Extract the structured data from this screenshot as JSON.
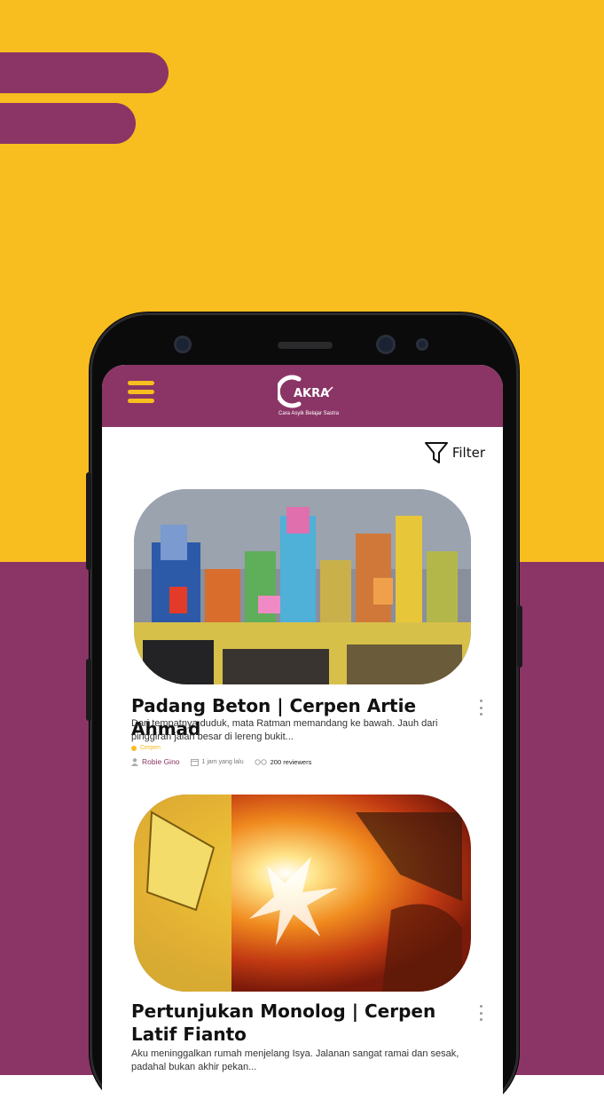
{
  "app": {
    "logo_text": "AKRA",
    "tagline": "Cara Asyik Belajar Sastra",
    "colors": {
      "primary": "#8A3566",
      "accent": "#F8BD1F",
      "background": "#ffffff"
    }
  },
  "toolbar": {
    "menu_icon": "hamburger-menu-icon",
    "filter_label": "Filter",
    "filter_icon": "funnel-icon"
  },
  "posts": [
    {
      "title": "Padang Beton | Cerpen Artie Ahmad",
      "excerpt": "Dari tempatnya duduk, mata Ratman memandang ke bawah. Jauh dari pinggiran jalan besar di lereng bukit...",
      "category": "Cerpen",
      "author": "Robie Gino",
      "time": "1 jam yang lalu",
      "reviewers": "200 reviewers"
    },
    {
      "title": "Pertunjukan Monolog | Cerpen Latif Fianto",
      "excerpt": "Aku meninggalkan rumah menjelang Isya. Jalanan sangat ramai dan sesak, padahal bukan akhir pekan..."
    }
  ]
}
